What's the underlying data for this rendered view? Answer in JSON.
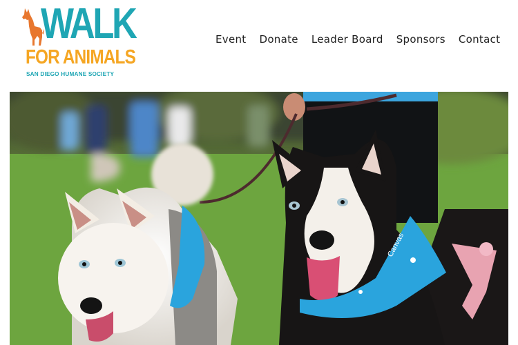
{
  "logo": {
    "line1": "WALK",
    "line2": "FOR ANIMALS",
    "line3": "SAN DIEGO HUMANE SOCIETY",
    "icon": "dog-silhouette-icon",
    "colors": {
      "teal": "#1fa6b4",
      "orange": "#f5a623",
      "dog": "#e8772e"
    }
  },
  "nav": {
    "items": [
      {
        "label": "Event"
      },
      {
        "label": "Donate"
      },
      {
        "label": "Leader Board"
      },
      {
        "label": "Sponsors"
      },
      {
        "label": "Contact"
      }
    ]
  },
  "hero": {
    "subject": "two husky dogs wearing blue bandanas on a walk"
  }
}
